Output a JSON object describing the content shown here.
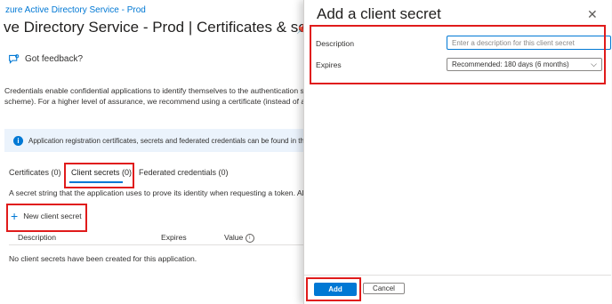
{
  "background_page": {
    "breadcrumb": "zure Active Directory Service - Prod",
    "title": "ve Directory Service - Prod | Certificates & secrets",
    "pin_icon": "pin-icon",
    "feedback_label": "Got feedback?",
    "description_line1": "Credentials enable confidential applications to identify themselves to the authentication service wh",
    "description_line2": "scheme). For a higher level of assurance, we recommend using a certificate (instead of a client secre",
    "info_banner": "Application registration certificates, secrets and federated credentials can be found in the tabs belo",
    "tabs": [
      {
        "label": "Certificates (0)"
      },
      {
        "label": "Client secrets (0)"
      },
      {
        "label": "Federated credentials (0)"
      }
    ],
    "secret_description": "A secret string that the application uses to prove its identity when requesting a token. Also can be",
    "new_secret_button": "New client secret",
    "table_headers": [
      "Description",
      "Expires",
      "Value"
    ],
    "empty_message": "No client secrets have been created for this application."
  },
  "panel": {
    "title": "Add a client secret",
    "description_label": "Description",
    "description_placeholder": "Enter a description for this client secret",
    "expires_label": "Expires",
    "expires_value": "Recommended: 180 days (6 months)",
    "add_label": "Add",
    "cancel_label": "Cancel"
  },
  "colors": {
    "accent": "#0078d4",
    "highlight": "#e01b1b"
  }
}
